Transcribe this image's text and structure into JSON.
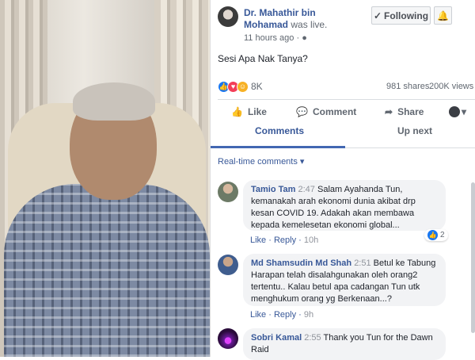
{
  "post": {
    "author": "Dr. Mahathir bin Mohamad",
    "status": "was live.",
    "time": "11 hours ago",
    "follow_label": "Following",
    "text": "Sesi Apa Nak Tanya?",
    "reaction_count": "8K",
    "shares": "981 shares",
    "views": "200K views"
  },
  "actions": {
    "like": "Like",
    "comment": "Comment",
    "share": "Share"
  },
  "tabs": {
    "comments": "Comments",
    "up_next": "Up next"
  },
  "filter_label": "Real-time comments",
  "comments": [
    {
      "author": "Tamio Tam",
      "time": "2:47",
      "text": "Salam Ayahanda Tun, kemanakah arah ekonomi dunia akibat drp kesan COVID 19. Adakah akan membawa kepada kemelesetan ekonomi global...",
      "like": "Like",
      "reply": "Reply",
      "age": "10h",
      "likes": "2"
    },
    {
      "author": "Md Shamsudin Md Shah",
      "time": "2:51",
      "text": "Betul ke Tabung Harapan telah disalahgunakan oleh orang2 tertentu.. Kalau betul apa cadangan Tun utk menghukum orang yg Berkenaan...?",
      "like": "Like",
      "reply": "Reply",
      "age": "9h"
    },
    {
      "author": "Sobri Kamal",
      "time": "2:55",
      "text": "Thank you Tun for the Dawn Raid"
    }
  ],
  "colors": {
    "link_blue": "#385898",
    "accent": "#4267b2",
    "muted": "#606770"
  },
  "icons": [
    "check-icon",
    "bell-icon",
    "globe-icon",
    "like-icon",
    "comment-icon",
    "share-icon",
    "caret-down-icon"
  ]
}
